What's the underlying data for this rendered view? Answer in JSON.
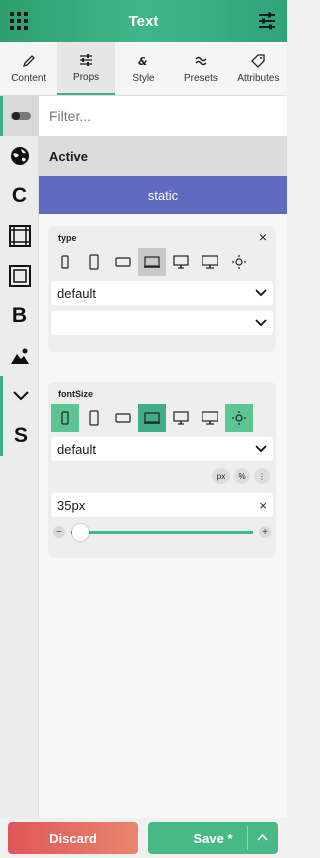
{
  "header": {
    "title": "Text"
  },
  "tabs": [
    {
      "label": "Content",
      "icon": "pencil-icon"
    },
    {
      "label": "Props",
      "icon": "sliders-icon",
      "active": true
    },
    {
      "label": "Style",
      "icon": "style-icon"
    },
    {
      "label": "Presets",
      "icon": "presets-icon"
    },
    {
      "label": "Attributes",
      "icon": "tag-icon"
    }
  ],
  "sidebar": {
    "items": [
      {
        "name": "toggle",
        "icon": "toggle-icon"
      },
      {
        "name": "globe",
        "icon": "globe-icon"
      },
      {
        "name": "c",
        "label": "C"
      },
      {
        "name": "frame",
        "icon": "frame-icon"
      },
      {
        "name": "box",
        "icon": "box-icon"
      },
      {
        "name": "b",
        "label": "B"
      },
      {
        "name": "image",
        "icon": "image-icon"
      },
      {
        "name": "chevron",
        "icon": "chevron-down-icon"
      },
      {
        "name": "s",
        "label": "S"
      }
    ]
  },
  "filter": {
    "placeholder": "Filter..."
  },
  "active": {
    "label": "Active",
    "button": "static"
  },
  "type_panel": {
    "label": "type",
    "close": "×",
    "select1": "default",
    "select2": ""
  },
  "font_panel": {
    "label": "fontSize",
    "select": "default",
    "units": [
      "px",
      "%",
      "⋮"
    ],
    "value": "35px",
    "clear": "×",
    "slider": {
      "minus": "−",
      "plus": "+",
      "value_fraction": 0.05
    }
  },
  "footer": {
    "discard": "Discard",
    "save": "Save *"
  },
  "colors": {
    "accent": "#3fae86",
    "indigo": "#5f6bbf",
    "danger": "#e0565a"
  }
}
